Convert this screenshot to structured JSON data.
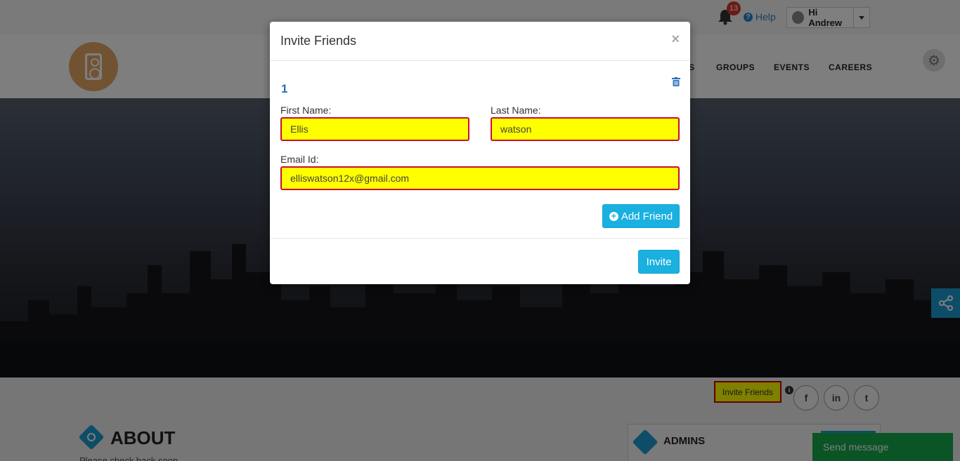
{
  "header": {
    "notification_count": "13",
    "help_label": "Help",
    "user_greeting": "Hi Andrew"
  },
  "nav": {
    "items": [
      "S",
      "GROUPS",
      "EVENTS",
      "CAREERS"
    ]
  },
  "profile": {
    "invite_friends_label": "Invite Friends",
    "social": [
      "f",
      "in",
      "t"
    ],
    "about_title": "ABOUT",
    "about_text": "Please check back soon",
    "admins_title": "ADMINS",
    "send_message": "Send message"
  },
  "modal": {
    "title": "Invite Friends",
    "close_symbol": "×",
    "entry_number": "1",
    "first_name_label": "First Name:",
    "first_name_value": "Ellis",
    "last_name_label": "Last Name:",
    "last_name_value": "watson",
    "email_label": "Email Id:",
    "email_value": "elliswatson12x@gmail.com",
    "add_friend_label": "Add Friend",
    "invite_label": "Invite"
  },
  "colors": {
    "accent": "#1ab0e0",
    "highlight": "#ffff00",
    "error_border": "#c8102e",
    "send_message": "#15a94a"
  }
}
